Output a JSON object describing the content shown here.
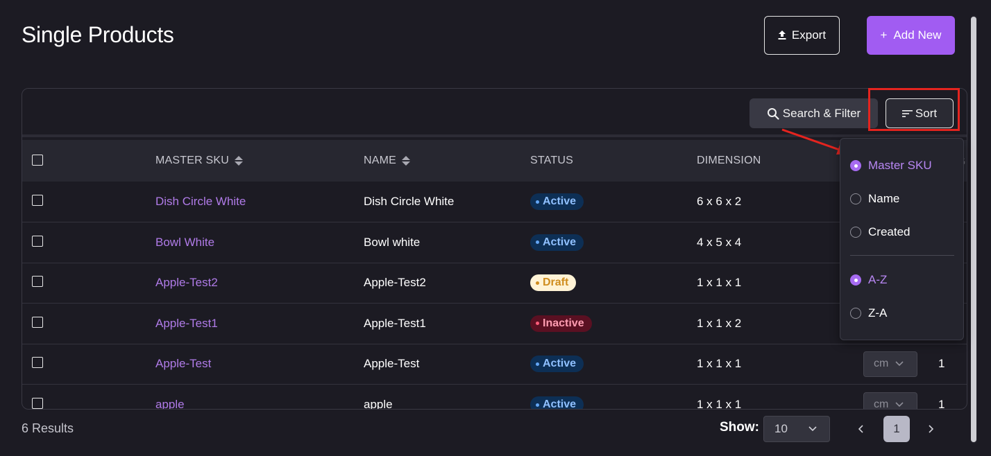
{
  "page": {
    "title": "Single Products",
    "export_label": "Export",
    "add_new_label": "Add New",
    "add_new_prefix": "+"
  },
  "toolbar": {
    "search_filter_label": "Search & Filter",
    "sort_label": "Sort"
  },
  "table": {
    "columns": [
      "MASTER SKU",
      "NAME",
      "STATUS",
      "DIMENSION"
    ],
    "clipped_header_char": "G",
    "rows": [
      {
        "sku": "Dish Circle White",
        "name": "Dish Circle White",
        "status": "Active",
        "dimension": "6 x 6 x 2"
      },
      {
        "sku": "Bowl White",
        "name": "Bowl white",
        "status": "Active",
        "dimension": "4 x 5 x 4"
      },
      {
        "sku": "Apple-Test2",
        "name": "Apple-Test2",
        "status": "Draft",
        "dimension": "1 x 1 x 1"
      },
      {
        "sku": "Apple-Test1",
        "name": "Apple-Test1",
        "status": "Inactive",
        "dimension": "1 x 1 x 2"
      },
      {
        "sku": "Apple-Test",
        "name": "Apple-Test",
        "status": "Active",
        "dimension": "1 x 1 x 1",
        "unit": "cm",
        "qty": "1"
      },
      {
        "sku": "apple",
        "name": "apple",
        "status": "Active",
        "dimension": "1 x 1 x 1",
        "unit": "cm",
        "qty": "1"
      }
    ]
  },
  "status_colors": {
    "Active": {
      "bg": "#0d2f55",
      "fg": "#8fc0ff",
      "dot": "#63a6f5"
    },
    "Draft": {
      "bg": "#fff3d6",
      "fg": "#cf8d1f",
      "dot": "#cf8d1f"
    },
    "Inactive": {
      "bg": "#5a1022",
      "fg": "#ff9db2",
      "dot": "#ff5c7a"
    }
  },
  "sort_menu": {
    "fields": [
      {
        "label": "Master SKU",
        "selected": true
      },
      {
        "label": "Name",
        "selected": false
      },
      {
        "label": "Created",
        "selected": false
      }
    ],
    "orders": [
      {
        "label": "A-Z",
        "selected": true
      },
      {
        "label": "Z-A",
        "selected": false
      }
    ]
  },
  "footer": {
    "results_text": "6 Results",
    "show_label": "Show:",
    "page_size": "10",
    "current_page": "1"
  },
  "colors": {
    "accent": "#a15cf2",
    "background": "#1c1b23",
    "annotation_red": "#e4241f"
  }
}
